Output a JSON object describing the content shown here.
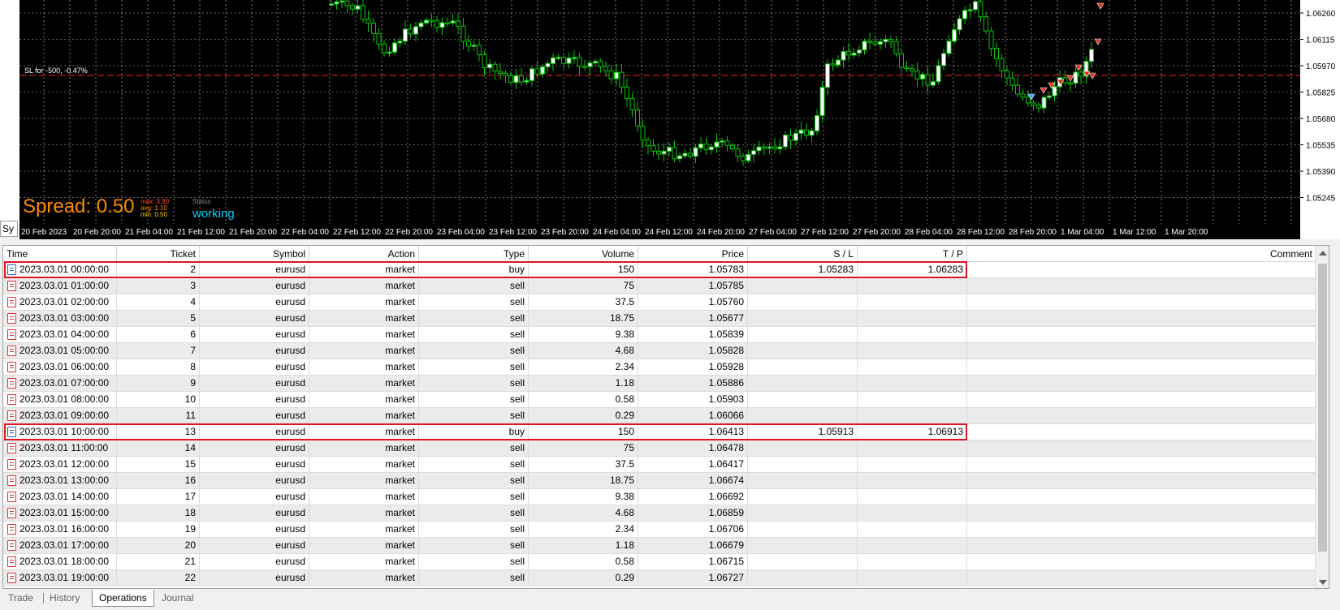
{
  "chart": {
    "background": "#000000",
    "grid_color": "#c8c8c8",
    "candle_color": "#00c800",
    "sl_line_color": "#c81e1e",
    "sl_label": "SL for -500, -0.47%",
    "spread_label": "Spread: 0.50",
    "spread_stats": [
      "max: 3.80",
      "avg: 1.10",
      "min: 0.50"
    ],
    "status_caption": "Status",
    "status_value": "working",
    "price_ticks": [
      "1.06260",
      "1.06115",
      "1.05970",
      "1.05825",
      "1.05680",
      "1.05535",
      "1.05390",
      "1.05245"
    ],
    "time_ticks": [
      "20 Feb 2023",
      "20 Feb 20:00",
      "21 Feb 04:00",
      "21 Feb 12:00",
      "21 Feb 20:00",
      "22 Feb 04:00",
      "22 Feb 12:00",
      "22 Feb 20:00",
      "23 Feb 04:00",
      "23 Feb 12:00",
      "23 Feb 20:00",
      "24 Feb 04:00",
      "24 Feb 12:00",
      "24 Feb 20:00",
      "27 Feb 04:00",
      "27 Feb 12:00",
      "27 Feb 20:00",
      "28 Feb 04:00",
      "28 Feb 12:00",
      "28 Feb 20:00",
      "1 Mar 04:00",
      "1 Mar 12:00",
      "1 Mar 20:00"
    ],
    "side_tab": "Sy"
  },
  "table": {
    "columns": [
      "Time",
      "Ticket",
      "Symbol",
      "Action",
      "Type",
      "Volume",
      "Price",
      "S / L",
      "T / P",
      "Comment"
    ],
    "rows": [
      {
        "time": "2023.03.01 00:00:00",
        "ticket": "2",
        "symbol": "eurusd",
        "action": "market",
        "type": "buy",
        "volume": "150",
        "price": "1.05783",
        "sl": "1.05283",
        "tp": "1.06283",
        "comment": ""
      },
      {
        "time": "2023.03.01 01:00:00",
        "ticket": "3",
        "symbol": "eurusd",
        "action": "market",
        "type": "sell",
        "volume": "75",
        "price": "1.05785",
        "sl": "",
        "tp": "",
        "comment": ""
      },
      {
        "time": "2023.03.01 02:00:00",
        "ticket": "4",
        "symbol": "eurusd",
        "action": "market",
        "type": "sell",
        "volume": "37.5",
        "price": "1.05760",
        "sl": "",
        "tp": "",
        "comment": ""
      },
      {
        "time": "2023.03.01 03:00:00",
        "ticket": "5",
        "symbol": "eurusd",
        "action": "market",
        "type": "sell",
        "volume": "18.75",
        "price": "1.05677",
        "sl": "",
        "tp": "",
        "comment": ""
      },
      {
        "time": "2023.03.01 04:00:00",
        "ticket": "6",
        "symbol": "eurusd",
        "action": "market",
        "type": "sell",
        "volume": "9.38",
        "price": "1.05839",
        "sl": "",
        "tp": "",
        "comment": ""
      },
      {
        "time": "2023.03.01 05:00:00",
        "ticket": "7",
        "symbol": "eurusd",
        "action": "market",
        "type": "sell",
        "volume": "4.68",
        "price": "1.05828",
        "sl": "",
        "tp": "",
        "comment": ""
      },
      {
        "time": "2023.03.01 06:00:00",
        "ticket": "8",
        "symbol": "eurusd",
        "action": "market",
        "type": "sell",
        "volume": "2.34",
        "price": "1.05928",
        "sl": "",
        "tp": "",
        "comment": ""
      },
      {
        "time": "2023.03.01 07:00:00",
        "ticket": "9",
        "symbol": "eurusd",
        "action": "market",
        "type": "sell",
        "volume": "1.18",
        "price": "1.05886",
        "sl": "",
        "tp": "",
        "comment": ""
      },
      {
        "time": "2023.03.01 08:00:00",
        "ticket": "10",
        "symbol": "eurusd",
        "action": "market",
        "type": "sell",
        "volume": "0.58",
        "price": "1.05903",
        "sl": "",
        "tp": "",
        "comment": ""
      },
      {
        "time": "2023.03.01 09:00:00",
        "ticket": "11",
        "symbol": "eurusd",
        "action": "market",
        "type": "sell",
        "volume": "0.29",
        "price": "1.06066",
        "sl": "",
        "tp": "",
        "comment": ""
      },
      {
        "time": "2023.03.01 10:00:00",
        "ticket": "13",
        "symbol": "eurusd",
        "action": "market",
        "type": "buy",
        "volume": "150",
        "price": "1.06413",
        "sl": "1.05913",
        "tp": "1.06913",
        "comment": ""
      },
      {
        "time": "2023.03.01 11:00:00",
        "ticket": "14",
        "symbol": "eurusd",
        "action": "market",
        "type": "sell",
        "volume": "75",
        "price": "1.06478",
        "sl": "",
        "tp": "",
        "comment": ""
      },
      {
        "time": "2023.03.01 12:00:00",
        "ticket": "15",
        "symbol": "eurusd",
        "action": "market",
        "type": "sell",
        "volume": "37.5",
        "price": "1.06417",
        "sl": "",
        "tp": "",
        "comment": ""
      },
      {
        "time": "2023.03.01 13:00:00",
        "ticket": "16",
        "symbol": "eurusd",
        "action": "market",
        "type": "sell",
        "volume": "18.75",
        "price": "1.06674",
        "sl": "",
        "tp": "",
        "comment": ""
      },
      {
        "time": "2023.03.01 14:00:00",
        "ticket": "17",
        "symbol": "eurusd",
        "action": "market",
        "type": "sell",
        "volume": "9.38",
        "price": "1.06692",
        "sl": "",
        "tp": "",
        "comment": ""
      },
      {
        "time": "2023.03.01 15:00:00",
        "ticket": "18",
        "symbol": "eurusd",
        "action": "market",
        "type": "sell",
        "volume": "4.68",
        "price": "1.06859",
        "sl": "",
        "tp": "",
        "comment": ""
      },
      {
        "time": "2023.03.01 16:00:00",
        "ticket": "19",
        "symbol": "eurusd",
        "action": "market",
        "type": "sell",
        "volume": "2.34",
        "price": "1.06706",
        "sl": "",
        "tp": "",
        "comment": ""
      },
      {
        "time": "2023.03.01 17:00:00",
        "ticket": "20",
        "symbol": "eurusd",
        "action": "market",
        "type": "sell",
        "volume": "1.18",
        "price": "1.06679",
        "sl": "",
        "tp": "",
        "comment": ""
      },
      {
        "time": "2023.03.01 18:00:00",
        "ticket": "21",
        "symbol": "eurusd",
        "action": "market",
        "type": "sell",
        "volume": "0.58",
        "price": "1.06715",
        "sl": "",
        "tp": "",
        "comment": ""
      },
      {
        "time": "2023.03.01 19:00:00",
        "ticket": "22",
        "symbol": "eurusd",
        "action": "market",
        "type": "sell",
        "volume": "0.29",
        "price": "1.06727",
        "sl": "",
        "tp": "",
        "comment": ""
      }
    ],
    "highlight_color": "#e0141e",
    "buy_icon_color": "#2e62c4",
    "sell_icon_color": "#e03030"
  },
  "tabs": [
    {
      "label": "Trade",
      "active": false
    },
    {
      "label": "History",
      "active": false
    },
    {
      "label": "Operations",
      "active": true
    },
    {
      "label": "Journal",
      "active": false
    }
  ]
}
